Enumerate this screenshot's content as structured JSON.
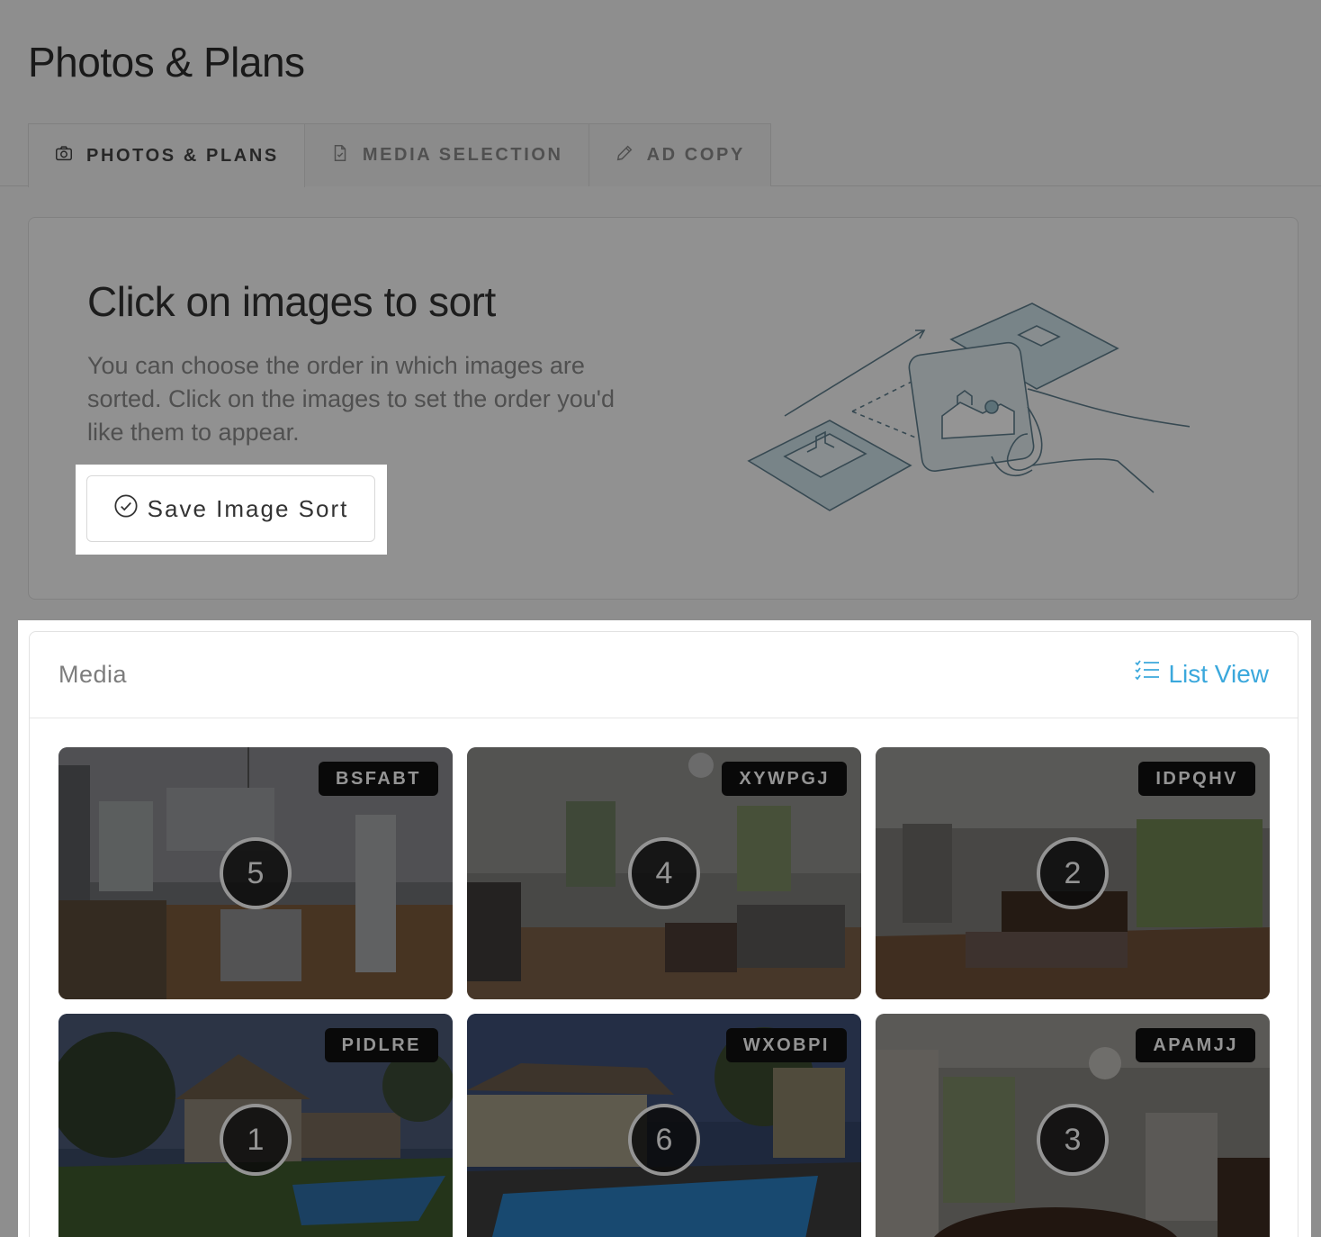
{
  "page": {
    "title": "Photos & Plans"
  },
  "tabs": [
    {
      "label": "PHOTOS & PLANS",
      "icon": "camera-icon",
      "active": true
    },
    {
      "label": "MEDIA SELECTION",
      "icon": "document-icon",
      "active": false
    },
    {
      "label": "AD COPY",
      "icon": "pencil-icon",
      "active": false
    }
  ],
  "info": {
    "heading": "Click on images to sort",
    "text": "You can choose the order in which images are sorted. Click on the images to set the order you'd like them to appear.",
    "save_label": "Save Image Sort",
    "illustration_icon": "sort-illustration-icon"
  },
  "media": {
    "title": "Media",
    "list_view_label": "List View",
    "items": [
      {
        "code": "BSFABT",
        "order": "5",
        "scene": "kitchen"
      },
      {
        "code": "XYWPGJ",
        "order": "4",
        "scene": "living-room"
      },
      {
        "code": "IDPQHV",
        "order": "2",
        "scene": "dining-room"
      },
      {
        "code": "PIDLRE",
        "order": "1",
        "scene": "house-exterior"
      },
      {
        "code": "WXOBPI",
        "order": "6",
        "scene": "pool"
      },
      {
        "code": "APAMJJ",
        "order": "3",
        "scene": "formal-dining"
      }
    ]
  },
  "colors": {
    "accent": "#3ba8dc",
    "overlay": "rgba(0,0,0,0.42)",
    "tag_bg": "#111111"
  }
}
